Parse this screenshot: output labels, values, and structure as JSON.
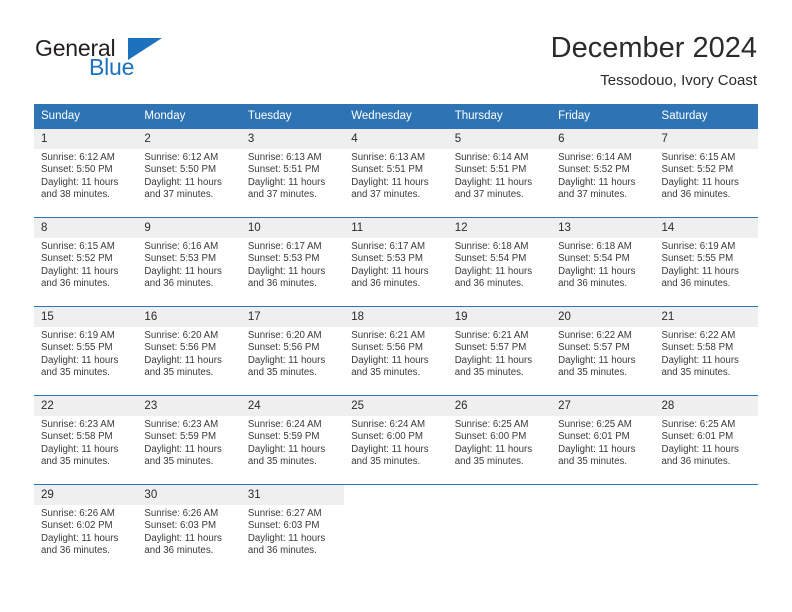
{
  "brand": {
    "word1": "General",
    "word2": "Blue",
    "accent_color": "#1c72bd",
    "triangle_icon": "triangle-logo-icon"
  },
  "header": {
    "title": "December 2024",
    "subtitle": "Tessodouo, Ivory Coast"
  },
  "calendar": {
    "header_bg": "#2e74b5",
    "daynum_bg": "#efefef",
    "weekdays": [
      "Sunday",
      "Monday",
      "Tuesday",
      "Wednesday",
      "Thursday",
      "Friday",
      "Saturday"
    ],
    "weeks": [
      [
        {
          "day": "1",
          "sunrise": "Sunrise: 6:12 AM",
          "sunset": "Sunset: 5:50 PM",
          "daylight1": "Daylight: 11 hours",
          "daylight2": "and 38 minutes."
        },
        {
          "day": "2",
          "sunrise": "Sunrise: 6:12 AM",
          "sunset": "Sunset: 5:50 PM",
          "daylight1": "Daylight: 11 hours",
          "daylight2": "and 37 minutes."
        },
        {
          "day": "3",
          "sunrise": "Sunrise: 6:13 AM",
          "sunset": "Sunset: 5:51 PM",
          "daylight1": "Daylight: 11 hours",
          "daylight2": "and 37 minutes."
        },
        {
          "day": "4",
          "sunrise": "Sunrise: 6:13 AM",
          "sunset": "Sunset: 5:51 PM",
          "daylight1": "Daylight: 11 hours",
          "daylight2": "and 37 minutes."
        },
        {
          "day": "5",
          "sunrise": "Sunrise: 6:14 AM",
          "sunset": "Sunset: 5:51 PM",
          "daylight1": "Daylight: 11 hours",
          "daylight2": "and 37 minutes."
        },
        {
          "day": "6",
          "sunrise": "Sunrise: 6:14 AM",
          "sunset": "Sunset: 5:52 PM",
          "daylight1": "Daylight: 11 hours",
          "daylight2": "and 37 minutes."
        },
        {
          "day": "7",
          "sunrise": "Sunrise: 6:15 AM",
          "sunset": "Sunset: 5:52 PM",
          "daylight1": "Daylight: 11 hours",
          "daylight2": "and 36 minutes."
        }
      ],
      [
        {
          "day": "8",
          "sunrise": "Sunrise: 6:15 AM",
          "sunset": "Sunset: 5:52 PM",
          "daylight1": "Daylight: 11 hours",
          "daylight2": "and 36 minutes."
        },
        {
          "day": "9",
          "sunrise": "Sunrise: 6:16 AM",
          "sunset": "Sunset: 5:53 PM",
          "daylight1": "Daylight: 11 hours",
          "daylight2": "and 36 minutes."
        },
        {
          "day": "10",
          "sunrise": "Sunrise: 6:17 AM",
          "sunset": "Sunset: 5:53 PM",
          "daylight1": "Daylight: 11 hours",
          "daylight2": "and 36 minutes."
        },
        {
          "day": "11",
          "sunrise": "Sunrise: 6:17 AM",
          "sunset": "Sunset: 5:53 PM",
          "daylight1": "Daylight: 11 hours",
          "daylight2": "and 36 minutes."
        },
        {
          "day": "12",
          "sunrise": "Sunrise: 6:18 AM",
          "sunset": "Sunset: 5:54 PM",
          "daylight1": "Daylight: 11 hours",
          "daylight2": "and 36 minutes."
        },
        {
          "day": "13",
          "sunrise": "Sunrise: 6:18 AM",
          "sunset": "Sunset: 5:54 PM",
          "daylight1": "Daylight: 11 hours",
          "daylight2": "and 36 minutes."
        },
        {
          "day": "14",
          "sunrise": "Sunrise: 6:19 AM",
          "sunset": "Sunset: 5:55 PM",
          "daylight1": "Daylight: 11 hours",
          "daylight2": "and 36 minutes."
        }
      ],
      [
        {
          "day": "15",
          "sunrise": "Sunrise: 6:19 AM",
          "sunset": "Sunset: 5:55 PM",
          "daylight1": "Daylight: 11 hours",
          "daylight2": "and 35 minutes."
        },
        {
          "day": "16",
          "sunrise": "Sunrise: 6:20 AM",
          "sunset": "Sunset: 5:56 PM",
          "daylight1": "Daylight: 11 hours",
          "daylight2": "and 35 minutes."
        },
        {
          "day": "17",
          "sunrise": "Sunrise: 6:20 AM",
          "sunset": "Sunset: 5:56 PM",
          "daylight1": "Daylight: 11 hours",
          "daylight2": "and 35 minutes."
        },
        {
          "day": "18",
          "sunrise": "Sunrise: 6:21 AM",
          "sunset": "Sunset: 5:56 PM",
          "daylight1": "Daylight: 11 hours",
          "daylight2": "and 35 minutes."
        },
        {
          "day": "19",
          "sunrise": "Sunrise: 6:21 AM",
          "sunset": "Sunset: 5:57 PM",
          "daylight1": "Daylight: 11 hours",
          "daylight2": "and 35 minutes."
        },
        {
          "day": "20",
          "sunrise": "Sunrise: 6:22 AM",
          "sunset": "Sunset: 5:57 PM",
          "daylight1": "Daylight: 11 hours",
          "daylight2": "and 35 minutes."
        },
        {
          "day": "21",
          "sunrise": "Sunrise: 6:22 AM",
          "sunset": "Sunset: 5:58 PM",
          "daylight1": "Daylight: 11 hours",
          "daylight2": "and 35 minutes."
        }
      ],
      [
        {
          "day": "22",
          "sunrise": "Sunrise: 6:23 AM",
          "sunset": "Sunset: 5:58 PM",
          "daylight1": "Daylight: 11 hours",
          "daylight2": "and 35 minutes."
        },
        {
          "day": "23",
          "sunrise": "Sunrise: 6:23 AM",
          "sunset": "Sunset: 5:59 PM",
          "daylight1": "Daylight: 11 hours",
          "daylight2": "and 35 minutes."
        },
        {
          "day": "24",
          "sunrise": "Sunrise: 6:24 AM",
          "sunset": "Sunset: 5:59 PM",
          "daylight1": "Daylight: 11 hours",
          "daylight2": "and 35 minutes."
        },
        {
          "day": "25",
          "sunrise": "Sunrise: 6:24 AM",
          "sunset": "Sunset: 6:00 PM",
          "daylight1": "Daylight: 11 hours",
          "daylight2": "and 35 minutes."
        },
        {
          "day": "26",
          "sunrise": "Sunrise: 6:25 AM",
          "sunset": "Sunset: 6:00 PM",
          "daylight1": "Daylight: 11 hours",
          "daylight2": "and 35 minutes."
        },
        {
          "day": "27",
          "sunrise": "Sunrise: 6:25 AM",
          "sunset": "Sunset: 6:01 PM",
          "daylight1": "Daylight: 11 hours",
          "daylight2": "and 35 minutes."
        },
        {
          "day": "28",
          "sunrise": "Sunrise: 6:25 AM",
          "sunset": "Sunset: 6:01 PM",
          "daylight1": "Daylight: 11 hours",
          "daylight2": "and 36 minutes."
        }
      ],
      [
        {
          "day": "29",
          "sunrise": "Sunrise: 6:26 AM",
          "sunset": "Sunset: 6:02 PM",
          "daylight1": "Daylight: 11 hours",
          "daylight2": "and 36 minutes."
        },
        {
          "day": "30",
          "sunrise": "Sunrise: 6:26 AM",
          "sunset": "Sunset: 6:03 PM",
          "daylight1": "Daylight: 11 hours",
          "daylight2": "and 36 minutes."
        },
        {
          "day": "31",
          "sunrise": "Sunrise: 6:27 AM",
          "sunset": "Sunset: 6:03 PM",
          "daylight1": "Daylight: 11 hours",
          "daylight2": "and 36 minutes."
        },
        {
          "day": "",
          "sunrise": "",
          "sunset": "",
          "daylight1": "",
          "daylight2": ""
        },
        {
          "day": "",
          "sunrise": "",
          "sunset": "",
          "daylight1": "",
          "daylight2": ""
        },
        {
          "day": "",
          "sunrise": "",
          "sunset": "",
          "daylight1": "",
          "daylight2": ""
        },
        {
          "day": "",
          "sunrise": "",
          "sunset": "",
          "daylight1": "",
          "daylight2": ""
        }
      ]
    ]
  }
}
